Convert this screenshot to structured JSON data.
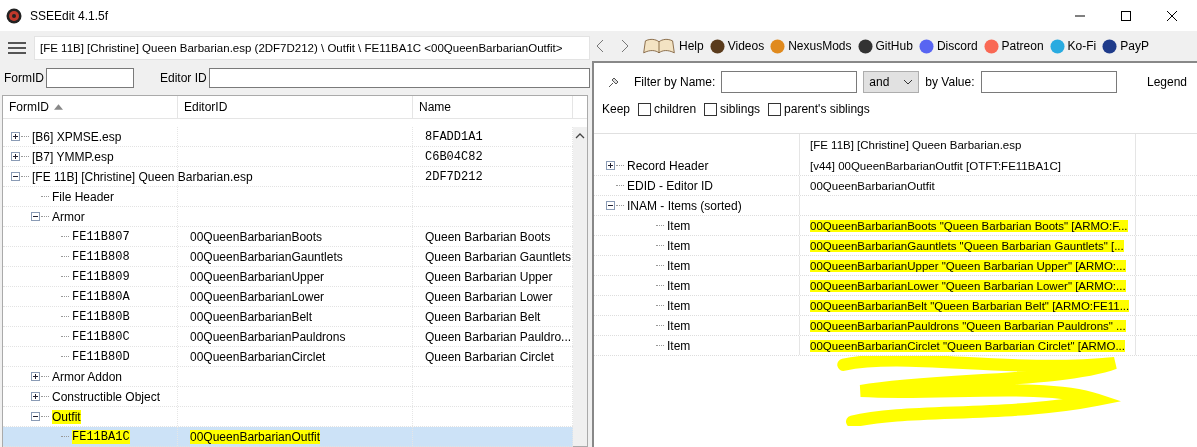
{
  "window": {
    "title": "SSEEdit 4.1.5f"
  },
  "path_field": {
    "value": "[FE 11B] [Christine] Queen Barbarian.esp (2DF7D212) \\ Outfit \\ FE11BA1C <00QueenBarbarianOutfit>"
  },
  "search": {
    "form_id_label": "FormID",
    "editor_id_label": "Editor ID"
  },
  "tree": {
    "columns": [
      {
        "label": "FormID",
        "sorted": true
      },
      {
        "label": "EditorID",
        "sorted": false
      },
      {
        "label": "Name",
        "sorted": false
      }
    ],
    "rows": [
      {
        "label": "[B6] XPMSE.esp",
        "name": "8FADD1A1",
        "expanded": false
      },
      {
        "label": "[B7] YMMP.esp",
        "name": "C6B04C82",
        "expanded": false
      },
      {
        "label": "[FE 11B] [Christine] Queen Barbarian.esp",
        "name": "2DF7D212",
        "expanded": true,
        "children": [
          {
            "label": "File Header"
          },
          {
            "label": "Armor",
            "expanded": true,
            "children": [
              {
                "form_id": "FE11B807",
                "editor_id": "00QueenBarbarianBoots",
                "name": "Queen Barbarian Boots"
              },
              {
                "form_id": "FE11B808",
                "editor_id": "00QueenBarbarianGauntlets",
                "name": "Queen Barbarian Gauntlets"
              },
              {
                "form_id": "FE11B809",
                "editor_id": "00QueenBarbarianUpper",
                "name": "Queen Barbarian Upper"
              },
              {
                "form_id": "FE11B80A",
                "editor_id": "00QueenBarbarianLower",
                "name": "Queen Barbarian Lower"
              },
              {
                "form_id": "FE11B80B",
                "editor_id": "00QueenBarbarianBelt",
                "name": "Queen Barbarian Belt"
              },
              {
                "form_id": "FE11B80C",
                "editor_id": "00QueenBarbarianPauldrons",
                "name": "Queen Barbarian Pauldro..."
              },
              {
                "form_id": "FE11B80D",
                "editor_id": "00QueenBarbarianCirclet",
                "name": "Queen Barbarian Circlet"
              }
            ]
          },
          {
            "label": "Armor Addon",
            "expanded": false
          },
          {
            "label": "Constructible Object",
            "expanded": false
          },
          {
            "label": "Outfit",
            "expanded": true,
            "highlighted": true,
            "children": [
              {
                "form_id": "FE11BA1C",
                "editor_id": "00QueenBarbarianOutfit",
                "selected": true,
                "highlighted": true
              }
            ]
          }
        ]
      }
    ]
  },
  "links": [
    {
      "label": "Help"
    },
    {
      "label": "Videos"
    },
    {
      "label": "NexusMods"
    },
    {
      "label": "GitHub"
    },
    {
      "label": "Discord"
    },
    {
      "label": "Patreon"
    },
    {
      "label": "Ko-Fi"
    },
    {
      "label": "PayP"
    }
  ],
  "filter": {
    "name_label": "Filter by Name:",
    "operator": "and",
    "value_label": "by Value:",
    "legend": "Legend"
  },
  "keep": {
    "label": "Keep",
    "options": [
      {
        "label": "children",
        "checked": false
      },
      {
        "label": "siblings",
        "checked": false
      },
      {
        "label": "parent's siblings",
        "checked": false
      }
    ]
  },
  "record": {
    "column_header": "[FE 11B] [Christine] Queen Barbarian.esp",
    "rows": [
      {
        "label": "Record Header",
        "value": "[v44] 00QueenBarbarianOutfit [OTFT:FE11BA1C]",
        "expanded": false
      },
      {
        "label": "EDID - Editor ID",
        "value": "00QueenBarbarianOutfit"
      },
      {
        "label": "INAM - Items (sorted)",
        "expanded": true,
        "children": [
          {
            "label": "Item",
            "value": "00QueenBarbarianBoots \"Queen Barbarian Boots\" [ARMO:F...",
            "highlighted": true
          },
          {
            "label": "Item",
            "value": "00QueenBarbarianGauntlets \"Queen Barbarian Gauntlets\" [...",
            "highlighted": true
          },
          {
            "label": "Item",
            "value": "00QueenBarbarianUpper \"Queen Barbarian Upper\" [ARMO:...",
            "highlighted": true
          },
          {
            "label": "Item",
            "value": "00QueenBarbarianLower \"Queen Barbarian Lower\" [ARMO:...",
            "highlighted": true
          },
          {
            "label": "Item",
            "value": "00QueenBarbarianBelt \"Queen Barbarian Belt\" [ARMO:FE11...",
            "highlighted": true
          },
          {
            "label": "Item",
            "value": "00QueenBarbarianPauldrons \"Queen Barbarian Pauldrons\" ...",
            "highlighted": true
          },
          {
            "label": "Item",
            "value": "00QueenBarbarianCirclet \"Queen Barbarian Circlet\" [ARMO...",
            "highlighted": true
          }
        ]
      }
    ]
  }
}
